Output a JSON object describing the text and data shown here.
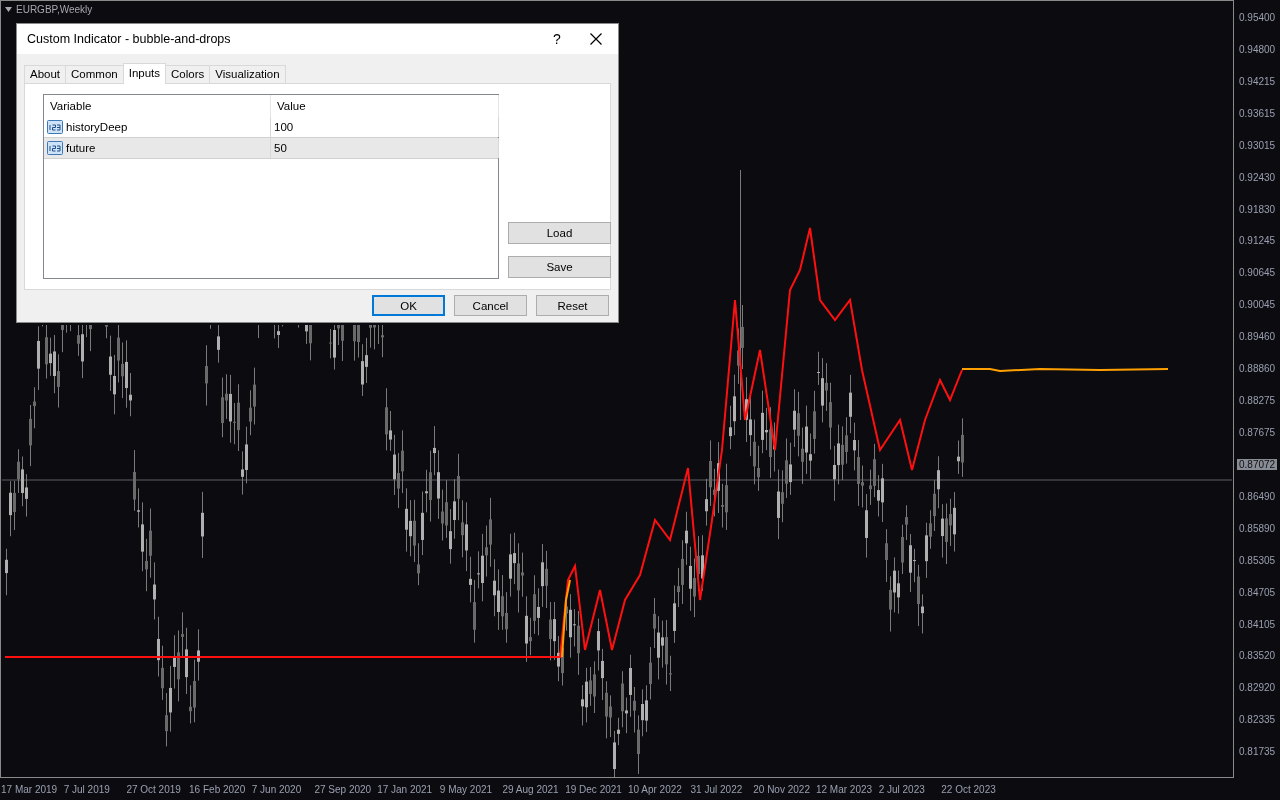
{
  "chart": {
    "title": "EURGBP,Weekly",
    "price_axis": [
      {
        "label": "0.95400",
        "current": false
      },
      {
        "label": "0.94800",
        "current": false
      },
      {
        "label": "0.94215",
        "current": false
      },
      {
        "label": "0.93615",
        "current": false
      },
      {
        "label": "0.93015",
        "current": false
      },
      {
        "label": "0.92430",
        "current": false
      },
      {
        "label": "0.91830",
        "current": false
      },
      {
        "label": "0.91245",
        "current": false
      },
      {
        "label": "0.90645",
        "current": false
      },
      {
        "label": "0.90045",
        "current": false
      },
      {
        "label": "0.89460",
        "current": false
      },
      {
        "label": "0.88860",
        "current": false
      },
      {
        "label": "0.88275",
        "current": false
      },
      {
        "label": "0.87675",
        "current": false
      },
      {
        "label": "0.87072",
        "current": true
      },
      {
        "label": "0.86490",
        "current": false
      },
      {
        "label": "0.85890",
        "current": false
      },
      {
        "label": "0.85305",
        "current": false
      },
      {
        "label": "0.84705",
        "current": false
      },
      {
        "label": "0.84105",
        "current": false
      },
      {
        "label": "0.83520",
        "current": false
      },
      {
        "label": "0.82920",
        "current": false
      },
      {
        "label": "0.82335",
        "current": false
      },
      {
        "label": "0.81735",
        "current": false
      }
    ],
    "date_axis": [
      "17 Mar 2019",
      "7 Jul 2019",
      "27 Oct 2019",
      "16 Feb 2020",
      "7 Jun 2020",
      "27 Sep 2020",
      "17 Jan 2021",
      "9 May 2021",
      "29 Aug 2021",
      "19 Dec 2021",
      "10 Apr 2022",
      "31 Jul 2022",
      "20 Nov 2022",
      "12 Mar 2023",
      "2 Jul 2023",
      "22 Oct 2023"
    ]
  },
  "dialog": {
    "title": "Custom Indicator - bubble-and-drops",
    "help": "?",
    "tabs": [
      {
        "label": "About",
        "selected": false
      },
      {
        "label": "Common",
        "selected": false
      },
      {
        "label": "Inputs",
        "selected": true
      },
      {
        "label": "Colors",
        "selected": false
      },
      {
        "label": "Visualization",
        "selected": false
      }
    ],
    "table": {
      "columns": [
        "Variable",
        "Value"
      ],
      "rows": [
        {
          "variable": "historyDeep",
          "value": "100",
          "selected": false
        },
        {
          "variable": "future",
          "value": "50",
          "selected": true
        }
      ]
    },
    "side_buttons": [
      "Load",
      "Save"
    ],
    "buttons": [
      {
        "label": "OK",
        "default": true
      },
      {
        "label": "Cancel",
        "default": false
      },
      {
        "label": "Reset",
        "default": false
      }
    ]
  }
}
